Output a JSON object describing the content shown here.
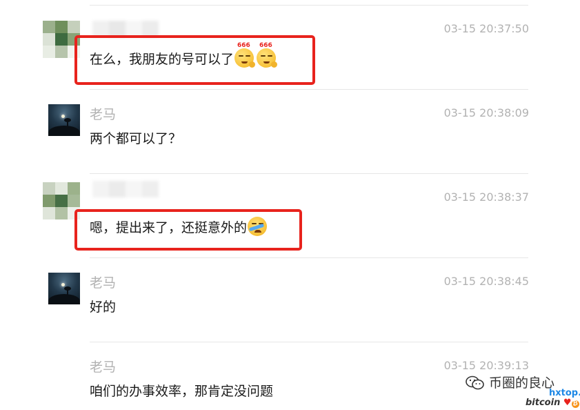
{
  "colors": {
    "highlight": "#e8231d",
    "text": "#191919",
    "meta": "#b2b2b2",
    "watermark_sub": "#1e88e5"
  },
  "messages": [
    {
      "sender": "",
      "time": "03-15 20:37:50",
      "text": "在么，我朋友的号可以了",
      "emoji": [
        "666-smirk-emoji",
        "666-smirk-emoji"
      ],
      "emoji_badge": "666",
      "highlighted": true
    },
    {
      "sender": "老马",
      "time": "03-15 20:38:09",
      "text": "两个都可以了？",
      "highlighted": false
    },
    {
      "sender": "",
      "time": "03-15 20:38:37",
      "text": "嗯，提出来了，还挺意外的",
      "emoji": [
        "crying-laughing-emoji"
      ],
      "highlighted": true
    },
    {
      "sender": "老马",
      "time": "03-15 20:38:45",
      "text": "好的",
      "highlighted": false
    },
    {
      "sender": "老马",
      "time": "03-15 20:39:13",
      "text": "咱们的办事效率，那肯定没问题",
      "highlighted": false
    }
  ],
  "watermark": {
    "title": "币圈的良心",
    "site": "hxtop.com",
    "tag": "bitcoin",
    "icon": "wechat-icon"
  }
}
